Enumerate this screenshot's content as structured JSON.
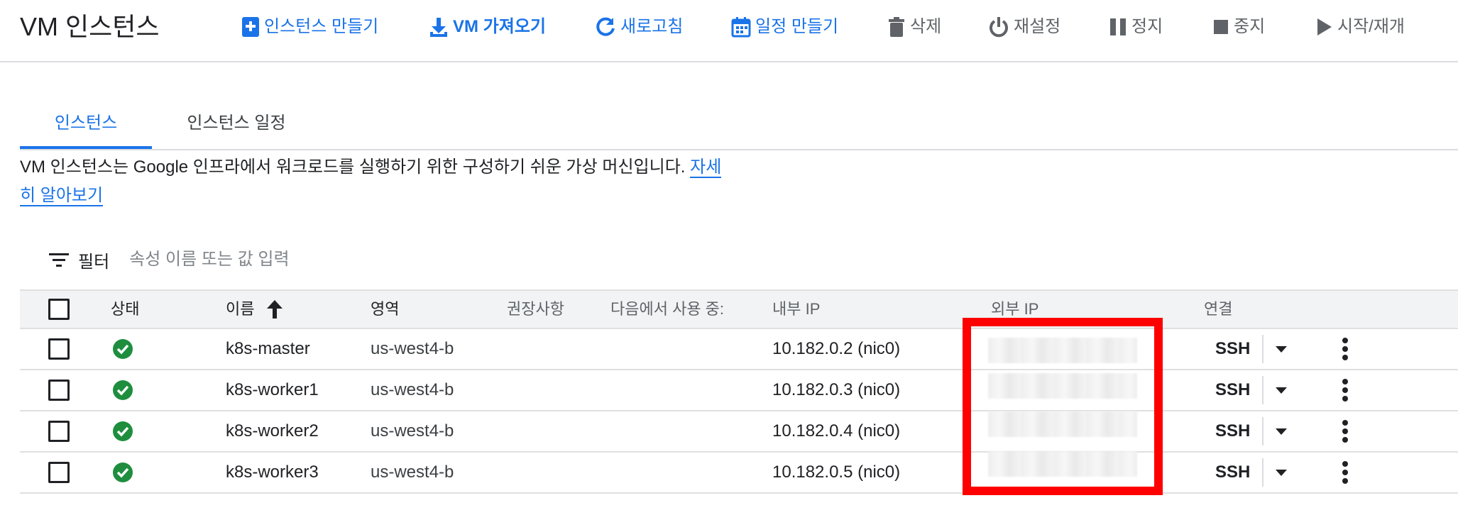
{
  "header": {
    "title": "VM 인스턴스",
    "actions": [
      {
        "label": "인스턴스 만들기",
        "icon": "add-box-icon"
      },
      {
        "label": "VM 가져오기",
        "icon": "download-icon"
      },
      {
        "label": "새로고침",
        "icon": "refresh-icon"
      },
      {
        "label": "일정 만들기",
        "icon": "calendar-icon"
      },
      {
        "label": "삭제",
        "icon": "trash-icon"
      },
      {
        "label": "재설정",
        "icon": "power-icon"
      },
      {
        "label": "정지",
        "icon": "pause-icon"
      },
      {
        "label": "중지",
        "icon": "stop-icon"
      },
      {
        "label": "시작/재개",
        "icon": "play-icon"
      }
    ]
  },
  "tabs": [
    {
      "label": "인스턴스",
      "active": true
    },
    {
      "label": "인스턴스 일정",
      "active": false
    }
  ],
  "description": {
    "text": "VM 인스턴스는 Google 인프라에서 워크로드를 실행하기 위한 구성하기 쉬운 가상 머신입니다. ",
    "link_line1": "자세",
    "link_line2": "히 알아보기"
  },
  "filter": {
    "label": "필터",
    "placeholder": "속성 이름 또는 값 입력",
    "icon": "filter-icon"
  },
  "table": {
    "columns": [
      "상태",
      "이름",
      "영역",
      "권장사항",
      "다음에서 사용 중:",
      "내부 IP",
      "외부 IP",
      "연결"
    ],
    "sort_icon": "arrow-up-icon",
    "rows": [
      {
        "status": "running",
        "name": "k8s-master",
        "zone": "us-west4-b",
        "internal_ip": "10.182.0.2 (nic0)",
        "connect": "SSH"
      },
      {
        "status": "running",
        "name": "k8s-worker1",
        "zone": "us-west4-b",
        "internal_ip": "10.182.0.3 (nic0)",
        "connect": "SSH"
      },
      {
        "status": "running",
        "name": "k8s-worker2",
        "zone": "us-west4-b",
        "internal_ip": "10.182.0.4 (nic0)",
        "connect": "SSH"
      },
      {
        "status": "running",
        "name": "k8s-worker3",
        "zone": "us-west4-b",
        "internal_ip": "10.182.0.5 (nic0)",
        "connect": "SSH"
      }
    ]
  },
  "colors": {
    "accent": "#1a73e8",
    "status_green": "#1e8e3e",
    "highlight_red": "#ff0000",
    "header_bg": "#f1f3f4"
  }
}
